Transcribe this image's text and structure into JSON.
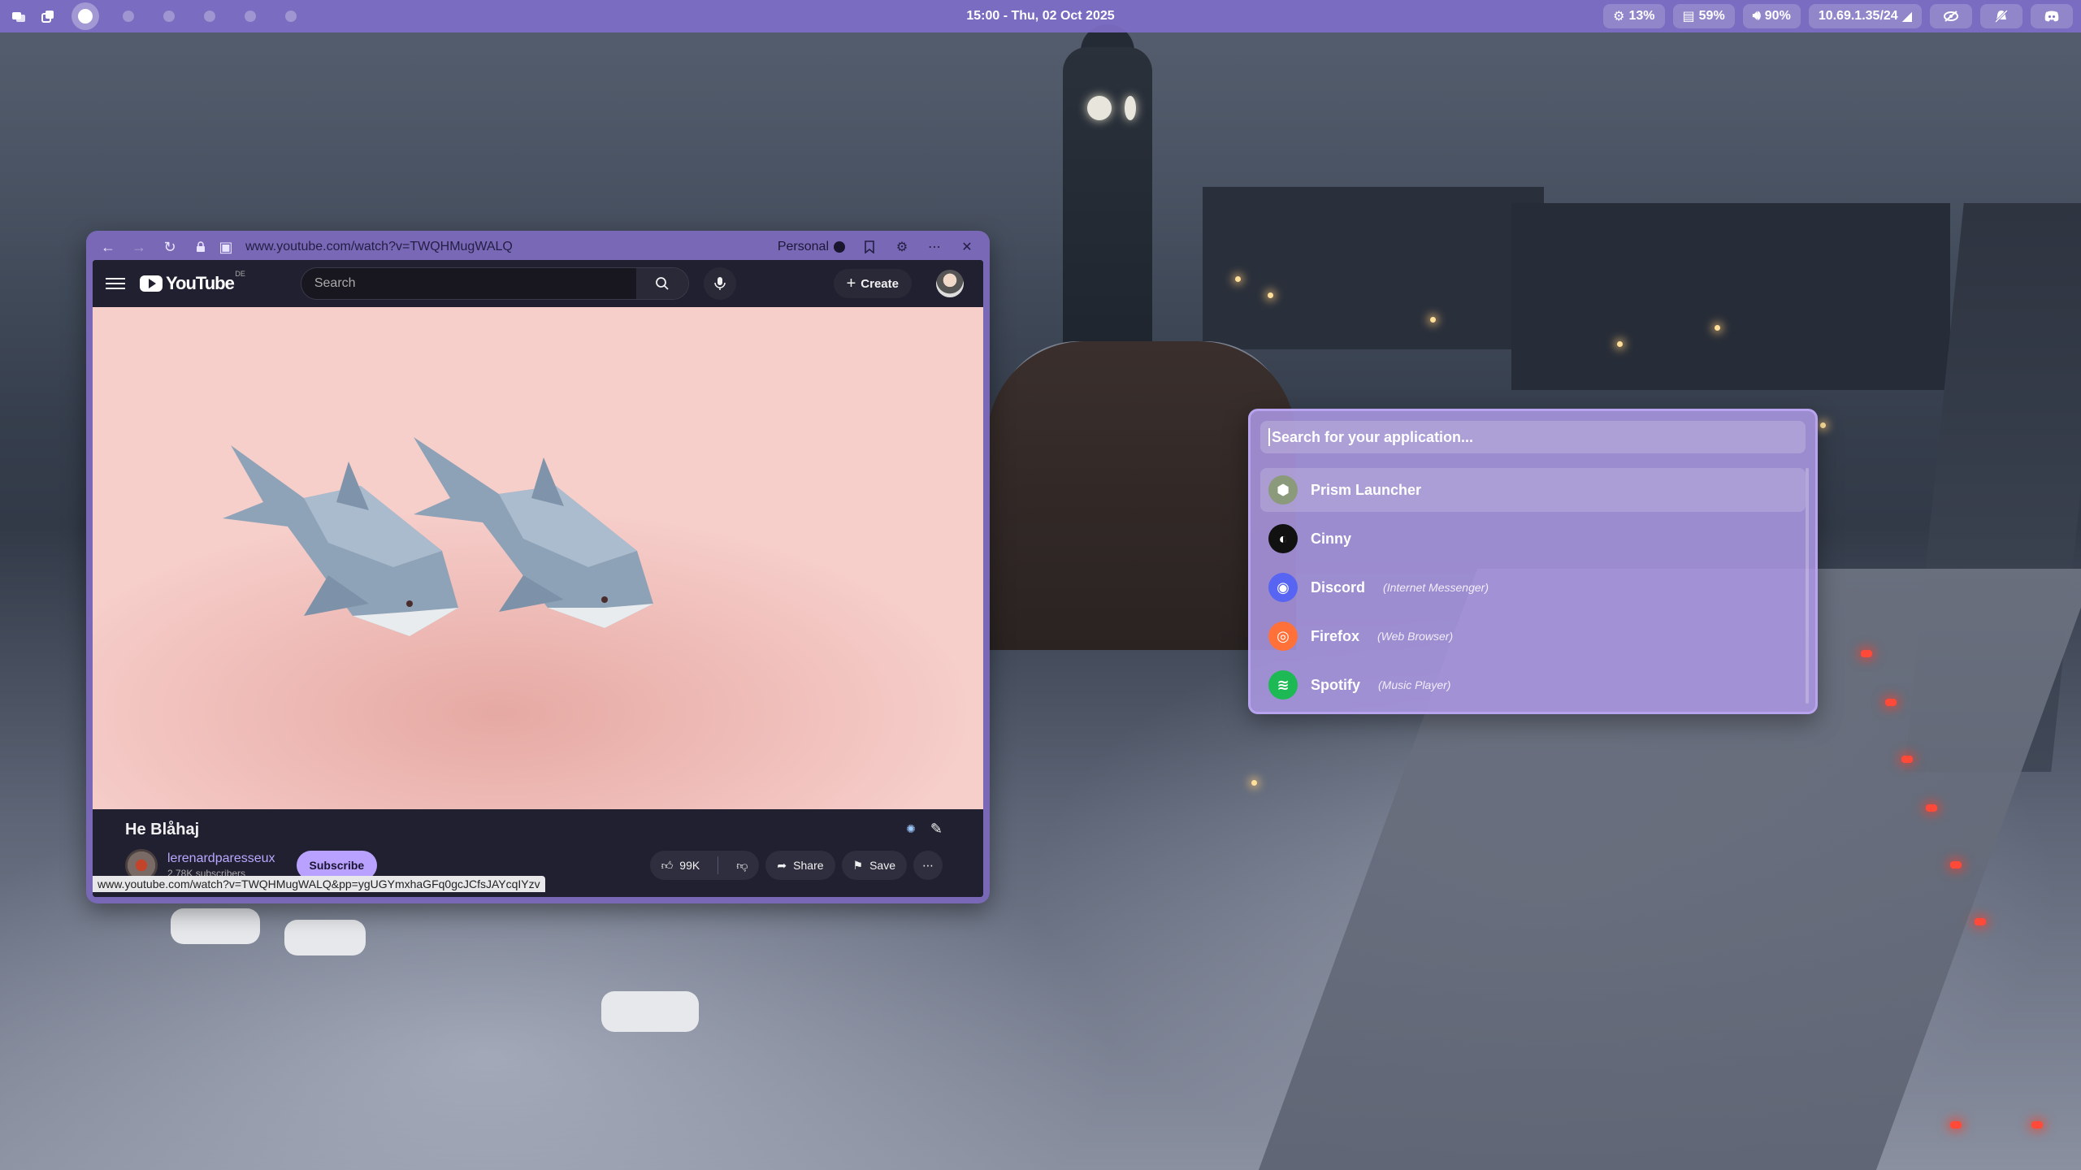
{
  "topbar": {
    "clock": "15:00 - Thu, 02 Oct 2025",
    "cpu": "13%",
    "memory": "59%",
    "volume": "90%",
    "network": "10.69.1.35/24",
    "workspaces": [
      "1",
      "2",
      "3",
      "4",
      "5",
      "6"
    ],
    "active_workspace": 0
  },
  "browser": {
    "url": "www.youtube.com/watch?v=TWQHMugWALQ",
    "profile": "Personal",
    "status_url": "www.youtube.com/watch?v=TWQHMugWALQ&pp=ygUGYmxhaGFq0gcJCfsJAYcqIYzv",
    "youtube": {
      "logo": "YouTube",
      "region": "DE",
      "search_placeholder": "Search",
      "create_label": "Create",
      "video_title": "He Blåhaj",
      "channel_name": "lerenardparesseux",
      "subscribers": "2.78K subscribers",
      "subscribe_label": "Subscribe",
      "likes": "99K",
      "share_label": "Share",
      "save_label": "Save"
    }
  },
  "launcher": {
    "placeholder": "Search for your application...",
    "apps": [
      {
        "name": "Prism Launcher",
        "desc": "",
        "icon": "prism-icon",
        "color": "#8a9a7a",
        "selected": true
      },
      {
        "name": "Cinny",
        "desc": "",
        "icon": "cinny-icon",
        "color": "#111111",
        "selected": false
      },
      {
        "name": "Discord",
        "desc": "(Internet Messenger)",
        "icon": "discord-icon",
        "color": "#5865f2",
        "selected": false
      },
      {
        "name": "Firefox",
        "desc": "(Web Browser)",
        "icon": "firefox-icon",
        "color": "#ff7139",
        "selected": false
      },
      {
        "name": "Spotify",
        "desc": "(Music Player)",
        "icon": "spotify-icon",
        "color": "#1db954",
        "selected": false
      }
    ]
  }
}
